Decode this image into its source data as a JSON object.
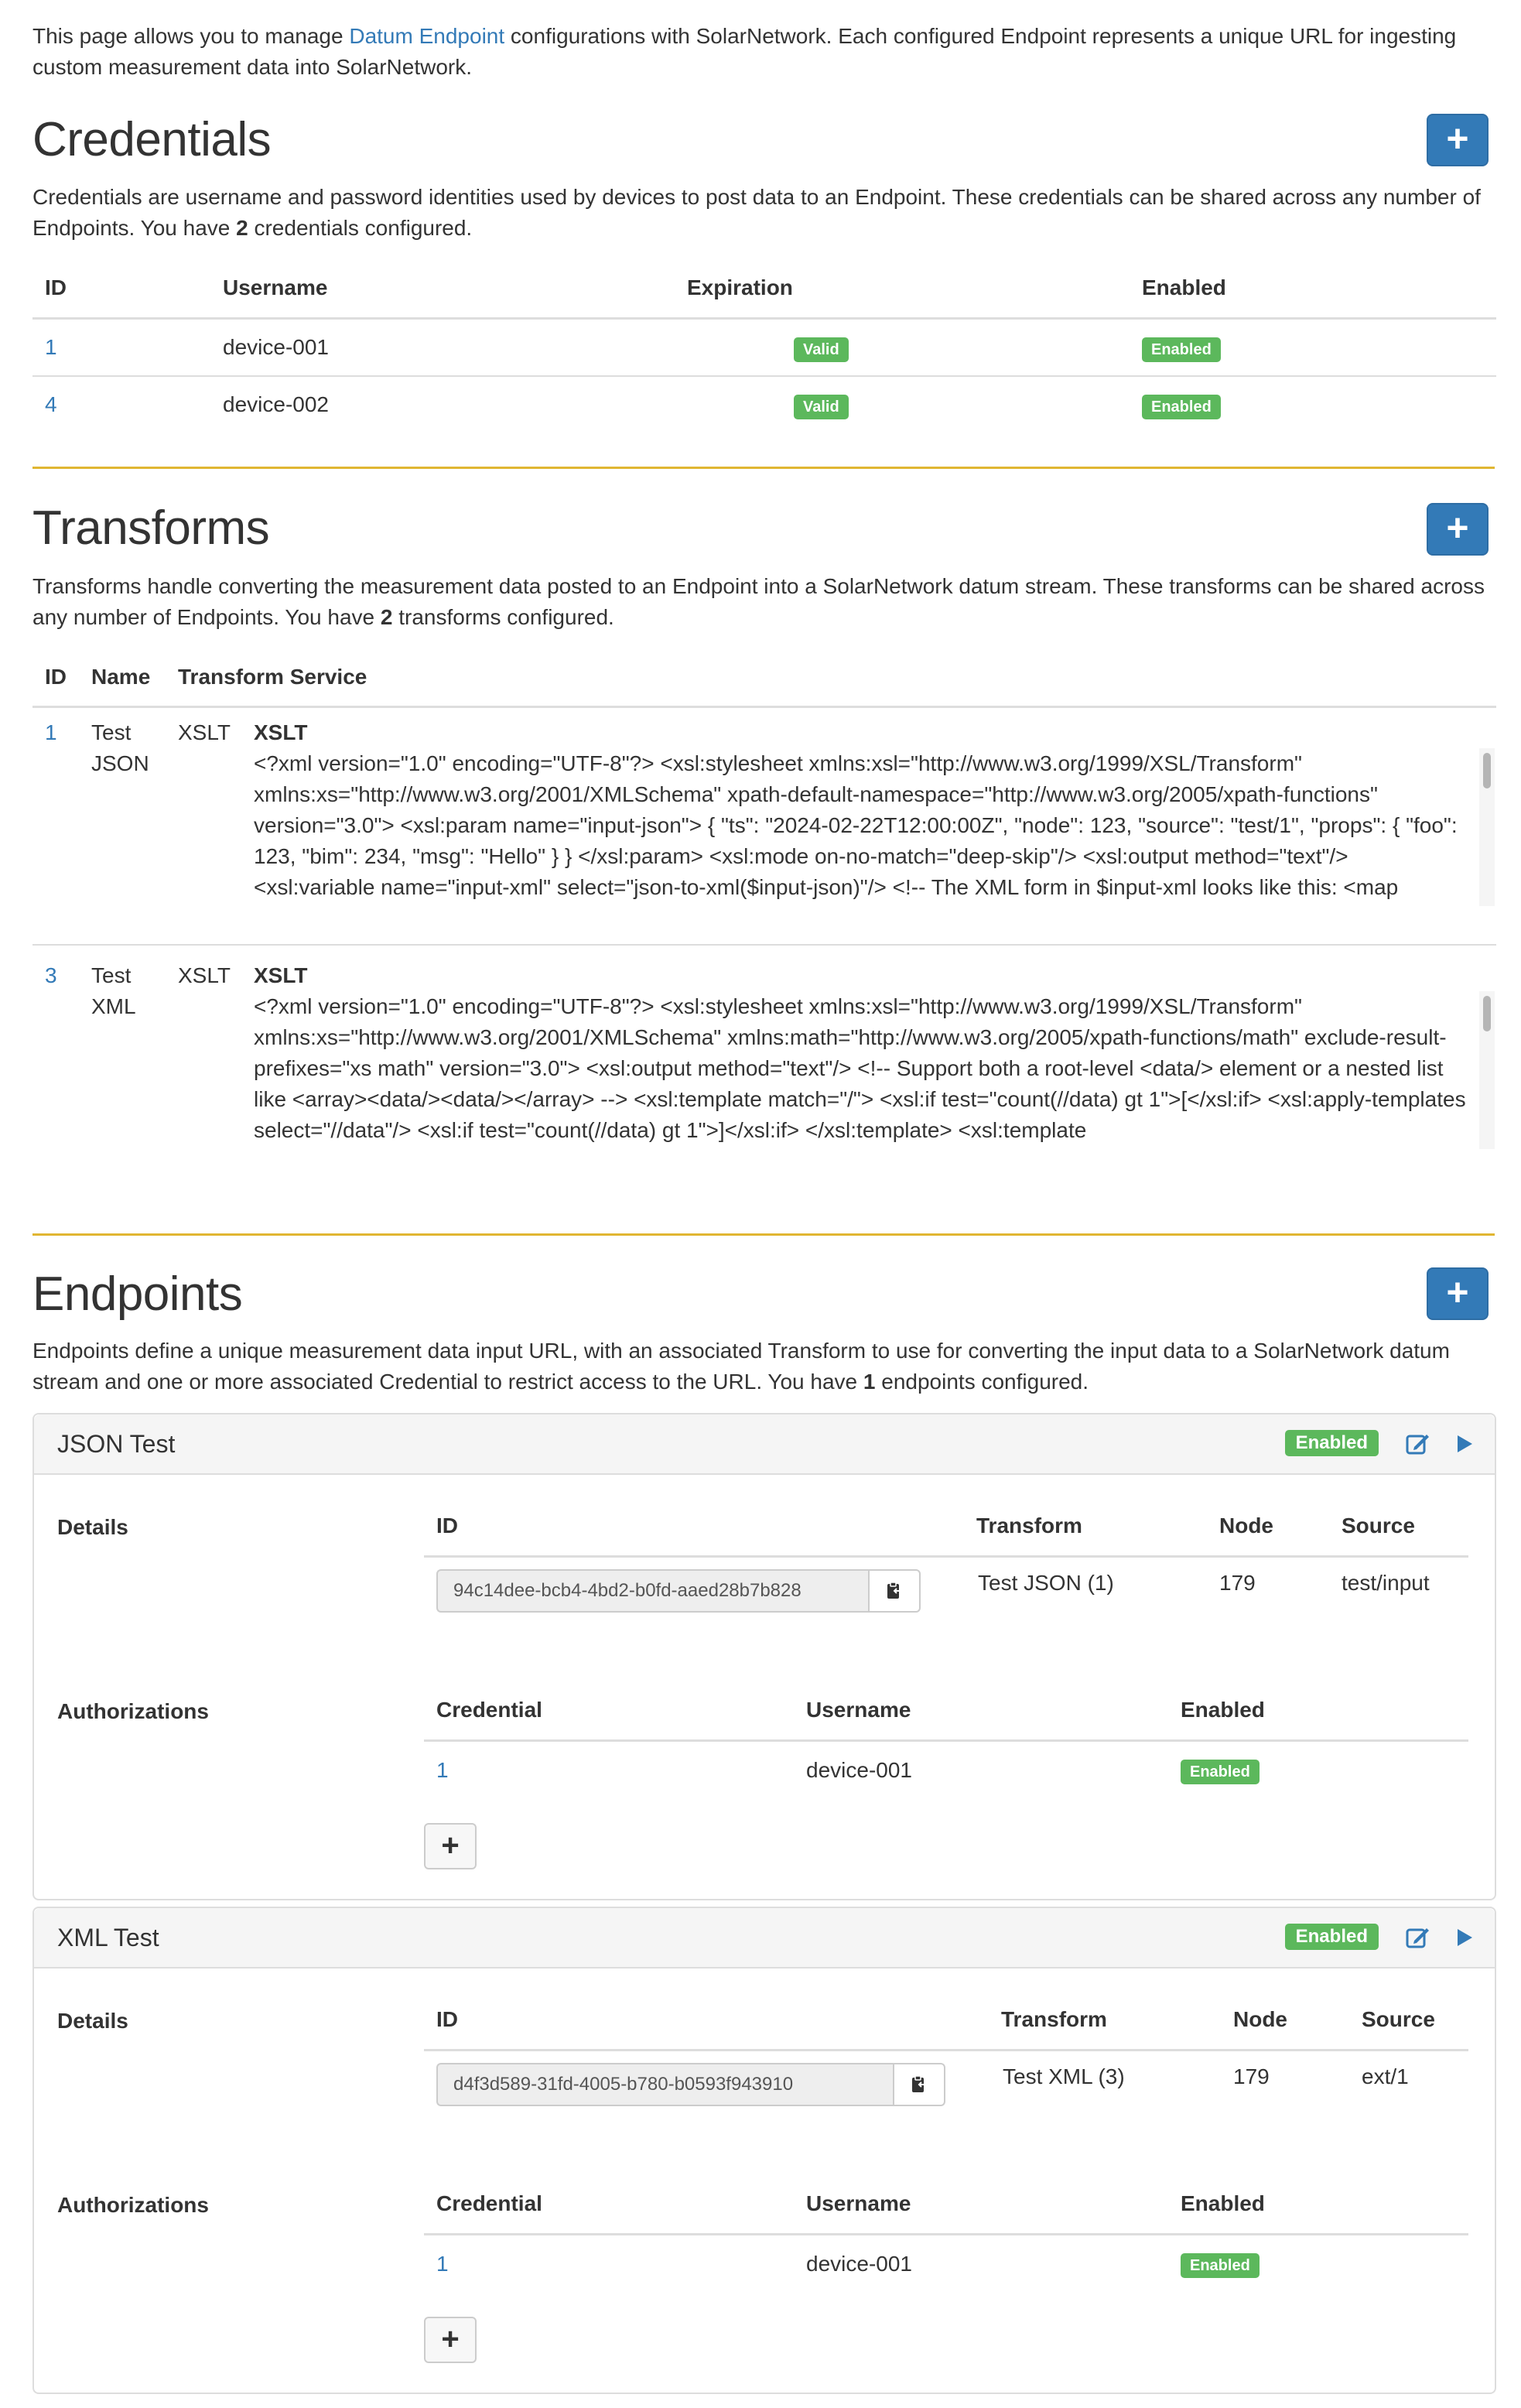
{
  "intro": {
    "before": "This page allows you to manage ",
    "link": "Datum Endpoint",
    "after": " configurations with SolarNetwork. Each configured Endpoint represents a unique URL for ingesting custom measurement data into SolarNetwork."
  },
  "add_symbol": "+",
  "credentials": {
    "title": "Credentials",
    "desc_before": "Credentials are username and password identities used by devices to post data to an Endpoint. These credentials can be shared across any number of Endpoints. You have ",
    "count": "2",
    "desc_after": " credentials configured.",
    "headers": {
      "id": "ID",
      "username": "Username",
      "expiration": "Expiration",
      "enabled": "Enabled"
    },
    "rows": [
      {
        "id": "1",
        "username": "device-001",
        "expiration": "Valid",
        "enabled": "Enabled"
      },
      {
        "id": "4",
        "username": "device-002",
        "expiration": "Valid",
        "enabled": "Enabled"
      }
    ]
  },
  "transforms": {
    "title": "Transforms",
    "desc_before": "Transforms handle converting the measurement data posted to an Endpoint into a SolarNetwork datum stream. These transforms can be shared across any number of Endpoints. You have ",
    "count": "2",
    "desc_after": " transforms configured.",
    "headers": {
      "id": "ID",
      "name": "Name",
      "service": "Transform Service"
    },
    "rows": [
      {
        "id": "1",
        "name": "Test JSON",
        "service": "XSLT",
        "service_heading": "XSLT",
        "code": "<?xml version=\"1.0\" encoding=\"UTF-8\"?> <xsl:stylesheet xmlns:xsl=\"http://www.w3.org/1999/XSL/Transform\" xmlns:xs=\"http://www.w3.org/2001/XMLSchema\" xpath-default-namespace=\"http://www.w3.org/2005/xpath-functions\" version=\"3.0\"> <xsl:param name=\"input-json\"> { \"ts\": \"2024-02-22T12:00:00Z\", \"node\": 123, \"source\": \"test/1\", \"props\": { \"foo\": 123, \"bim\": 234, \"msg\": \"Hello\" } } </xsl:param> <xsl:mode on-no-match=\"deep-skip\"/> <xsl:output method=\"text\"/> <xsl:variable name=\"input-xml\" select=\"json-to-xml($input-json)\"/> <!-- The XML form in $input-xml looks like this: <map"
      },
      {
        "id": "3",
        "name": "Test XML",
        "service": "XSLT",
        "service_heading": "XSLT",
        "code": "<?xml version=\"1.0\" encoding=\"UTF-8\"?> <xsl:stylesheet xmlns:xsl=\"http://www.w3.org/1999/XSL/Transform\" xmlns:xs=\"http://www.w3.org/2001/XMLSchema\" xmlns:math=\"http://www.w3.org/2005/xpath-functions/math\" exclude-result-prefixes=\"xs math\" version=\"3.0\"> <xsl:output method=\"text\"/> <!-- Support both a root-level <data/> element or a nested list like <array><data/><data/></array> --> <xsl:template match=\"/\"> <xsl:if test=\"count(//data) gt 1\">[</xsl:if> <xsl:apply-templates select=\"//data\"/> <xsl:if test=\"count(//data) gt 1\">]</xsl:if> </xsl:template> <xsl:template"
      }
    ]
  },
  "endpoints": {
    "title": "Endpoints",
    "desc_before": "Endpoints define a unique measurement data input URL, with an associated Transform to use for converting the input data to a SolarNetwork datum stream and one or more associated Credential to restrict access to the URL. You have ",
    "count": "1",
    "desc_after": " endpoints configured.",
    "details_label": "Details",
    "auth_label": "Authorizations",
    "detail_headers": {
      "id": "ID",
      "transform": "Transform",
      "node": "Node",
      "source": "Source"
    },
    "auth_headers": {
      "credential": "Credential",
      "username": "Username",
      "enabled": "Enabled"
    },
    "items": [
      {
        "name": "JSON Test",
        "status": "Enabled",
        "id": "94c14dee-bcb4-4bd2-b0fd-aaed28b7b828",
        "transform": "Test JSON (1)",
        "node": "179",
        "source": "test/input",
        "auth": {
          "credential": "1",
          "username": "device-001",
          "enabled": "Enabled"
        }
      },
      {
        "name": "XML Test",
        "status": "Enabled",
        "id": "d4f3d589-31fd-4005-b780-b0593f943910",
        "transform": "Test XML (3)",
        "node": "179",
        "source": "ext/1",
        "auth": {
          "credential": "1",
          "username": "device-001",
          "enabled": "Enabled"
        }
      }
    ]
  },
  "colors": {
    "primary": "#337ab7",
    "success": "#5cb85c",
    "rule": "#e0b632"
  }
}
